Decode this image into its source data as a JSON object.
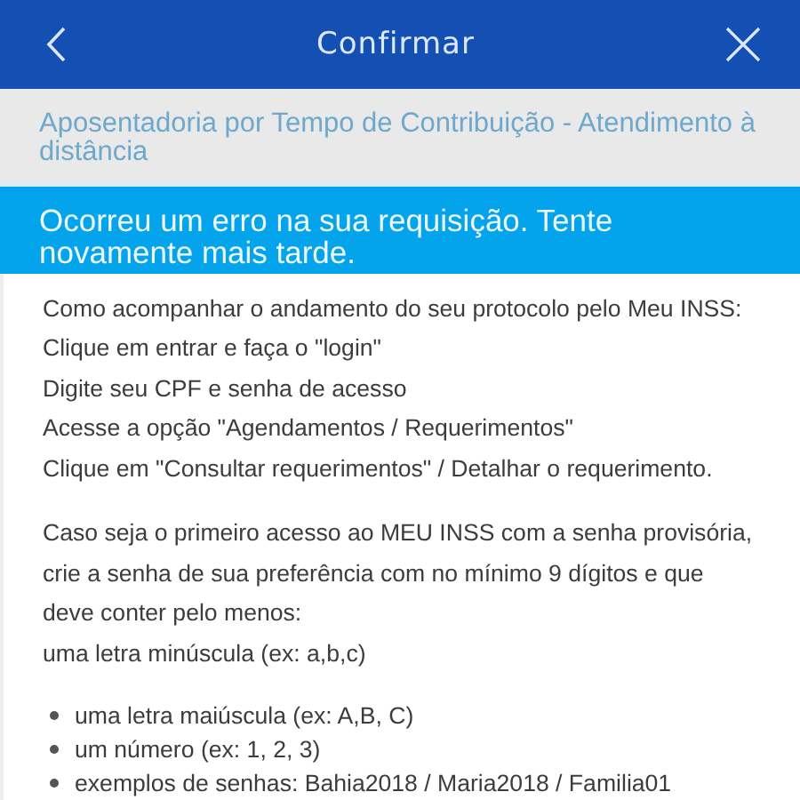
{
  "header": {
    "title": "Confirmar"
  },
  "service": {
    "title": "Aposentadoria por Tempo de Contribuição - Atendimento à distância"
  },
  "error": {
    "message": "Ocorreu um erro na sua requisição. Tente novamente mais tarde."
  },
  "instructions": {
    "lines": [
      "Como acompanhar o andamento do seu protocolo pelo Meu INSS:",
      "Clique em entrar e faça o \"login\"",
      "Digite seu CPF e senha de acesso",
      "Acesse a opção \"Agendamentos / Requerimentos\"",
      "Clique em \"Consultar requerimentos\" / Detalhar o requerimento."
    ]
  },
  "password_info": {
    "lines": [
      "Caso seja o primeiro acesso ao MEU INSS com a senha provisória, crie a senha de sua preferência com no mínimo 9 dígitos e que deve conter pelo menos:",
      "uma letra minúscula (ex: a,b,c)"
    ],
    "bullets": [
      "uma letra maiúscula (ex: A,B, C)",
      "um número (ex: 1, 2, 3)",
      "exemplos de senhas: Bahia2018 / Maria2018 / Familia01"
    ]
  }
}
